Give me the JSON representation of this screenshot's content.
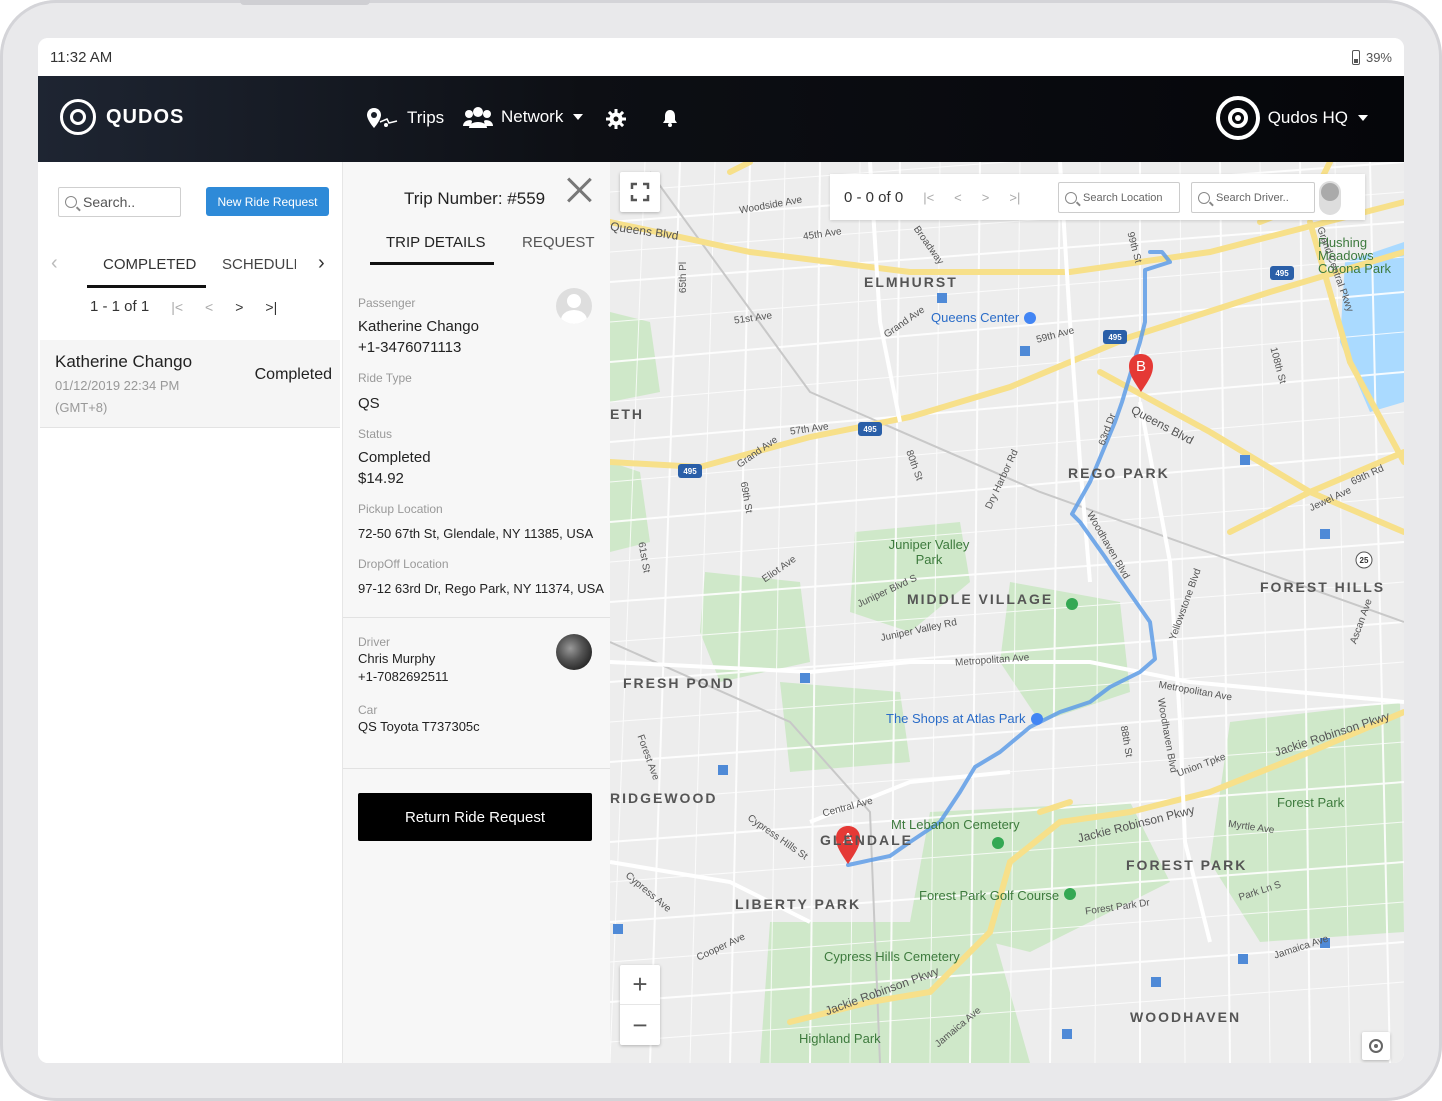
{
  "status_bar": {
    "time": "11:32 AM",
    "battery": "39%"
  },
  "nav": {
    "brand": "QUDOS",
    "trips": "Trips",
    "network": "Network",
    "account": "Qudos HQ"
  },
  "left": {
    "search_placeholder": "Search..",
    "new_ride_label": "New Ride Request",
    "tabs": [
      "COMPLETED",
      "SCHEDULED"
    ],
    "pager": {
      "range": "1 - 1 of 1",
      "first": "|<",
      "prev": "<",
      "next": ">",
      "last": ">|"
    },
    "trips": [
      {
        "name": "Katherine Chango",
        "date": "01/12/2019 22:34 PM",
        "tz": "(GMT+8)",
        "status": "Completed"
      }
    ]
  },
  "detail": {
    "trip_number": "Trip Number: #559",
    "tabs": [
      "TRIP DETAILS",
      "REQUEST"
    ],
    "passenger_label": "Passenger",
    "passenger_name": "Katherine Chango",
    "passenger_phone": "+1-3476071113",
    "ride_type_label": "Ride Type",
    "ride_type": "QS",
    "status_label": "Status",
    "status": "Completed",
    "fare": "$14.92",
    "pickup_label": "Pickup Location",
    "pickup": "72-50 67th St, Glendale, NY 11385, USA",
    "dropoff_label": "DropOff Location",
    "dropoff": "97-12 63rd Dr, Rego Park, NY 11374, USA",
    "driver_label": "Driver",
    "driver_name": "Chris Murphy",
    "driver_phone": "+1-7082692511",
    "car_label": "Car",
    "car": "QS Toyota T737305c",
    "return_label": "Return Ride Request"
  },
  "map": {
    "pager": {
      "range": "0 - 0 of 0",
      "first": "|<",
      "prev": "<",
      "next": ">",
      "last": ">|"
    },
    "search_location_placeholder": "Search Location",
    "search_driver_placeholder": "Search Driver..",
    "zoom_in": "+",
    "zoom_out": "−",
    "marker_a": "A",
    "marker_b": "B",
    "labels": {
      "elmhurst": "ELMHURST",
      "rego_park": "REGO PARK",
      "middle_village": "MIDDLE VILLAGE",
      "forest_hills": "FOREST HILLS",
      "fresh_pond": "FRESH POND",
      "ridgewood": "RIDGEWOOD",
      "glendale": "GLENDALE",
      "liberty_park": "LIBERTY PARK",
      "forest_park_area": "FOREST PARK",
      "woodhaven": "WOODHAVEN",
      "eth": "ETH",
      "queens_center": "Queens Center",
      "juniper_valley_park": "Juniper Valley Park",
      "shops_atlas_park": "The Shops at Atlas Park",
      "mt_lebanon": "Mt Lebanon Cemetery",
      "forest_park_golf": "Forest Park Golf Course",
      "cypress_hills_cemetery": "Cypress Hills Cemetery",
      "highland_park": "Highland Park",
      "forest_park": "Forest Park",
      "flushing_meadows": "Flushing Meadows Corona Park",
      "queens_blvd": "Queens Blvd",
      "queens_blvd_2": "Queens Blvd",
      "woodside_ave": "Woodside Ave",
      "ave_45th": "45th Ave",
      "st_51": "51st Ave",
      "ave_57th": "57th Ave",
      "grand_ave": "Grand Ave",
      "grand_ave_2": "Grand Ave",
      "eliot_ave": "Eliot Ave",
      "metropolitan_ave": "Metropolitan Ave",
      "metropolitan_ave_2": "Metropolitan Ave",
      "juniper_valley_rd": "Juniper Valley Rd",
      "juniper_blvd_s": "Juniper Blvd S",
      "woodhaven_blvd": "Woodhaven Blvd",
      "woodhaven_blvd_2": "Woodhaven Blvd",
      "yellowstone_blvd": "Yellowstone Blvd",
      "jackie_robinson_pkwy": "Jackie Robinson Pkwy",
      "jackie_robinson_pkwy_2": "Jackie Robinson Pkwy",
      "jackie_robinson_pkwy_3": "Jackie Robinson Pkwy",
      "union_tpke": "Union Tpke",
      "myrtle_ave": "Myrtle Ave",
      "central_ave": "Central Ave",
      "cypress_hills_st": "Cypress Hills St",
      "cypress_ave": "Cypress Ave",
      "cooper_ave": "Cooper Ave",
      "jamaica_ave": "Jamaica Ave",
      "jamaica_ave_2": "Jamaica Ave",
      "forest_park_dr": "Forest Park Dr",
      "park_ln_s": "Park Ln S",
      "jewel_ave": "Jewel Ave",
      "ave_59th": "59th Ave",
      "broadway": "Broadway",
      "st_69th": "69th St",
      "st_80th": "80th St",
      "st_88th": "88th St",
      "rd_63rd": "63rd Dr",
      "dry_harbor_rd": "Dry Harbor Rd",
      "ascan_ave": "Ascan Ave",
      "st_108th": "108th St",
      "st_99th": "99th St",
      "ave_grand_central": "Grand Central Pkwy",
      "st_65th": "65th Pl",
      "st_61st": "61st St",
      "forest_ave": "Forest Ave",
      "rd_69th": "69th Rd",
      "hwy_495": "495",
      "hwy_25": "25"
    }
  }
}
